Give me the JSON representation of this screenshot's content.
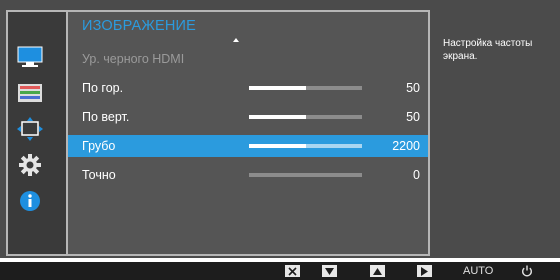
{
  "menu": {
    "title": "ИЗОБРАЖЕНИЕ",
    "items": [
      {
        "label": "Ур. черного HDMI",
        "value": "",
        "fill": null,
        "dim": true,
        "selected": false
      },
      {
        "label": "По гор.",
        "value": "50",
        "fill": 0.5,
        "dim": false,
        "selected": false
      },
      {
        "label": "По верт.",
        "value": "50",
        "fill": 0.5,
        "dim": false,
        "selected": false
      },
      {
        "label": "Грубо",
        "value": "2200",
        "fill": 0.5,
        "dim": false,
        "selected": true
      },
      {
        "label": "Точно",
        "value": "0",
        "fill": 0.0,
        "dim": false,
        "selected": false
      }
    ]
  },
  "tabs": [
    {
      "name": "picture-tab-icon",
      "active": true
    },
    {
      "name": "color-tab-icon",
      "active": false
    },
    {
      "name": "size-position-tab-icon",
      "active": false
    },
    {
      "name": "setup-tab-icon",
      "active": false
    },
    {
      "name": "information-tab-icon",
      "active": false
    }
  ],
  "help_text": "Настройка частоты экрана.",
  "bottom_bar": {
    "auto_label": "AUTO",
    "buttons": [
      "close-icon",
      "down-icon",
      "up-icon",
      "enter-icon",
      "auto",
      "power-icon"
    ]
  },
  "colors": {
    "accent": "#2b9bde",
    "panel": "#4b4b4b",
    "left_column": "#3a3a3a",
    "main_column": "#555555",
    "bottom_bar": "#1d1d1d"
  }
}
